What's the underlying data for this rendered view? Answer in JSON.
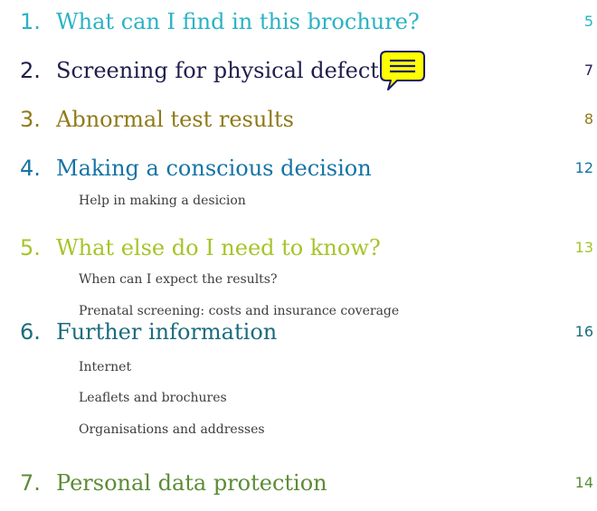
{
  "toc": {
    "entries": [
      {
        "number": "1.",
        "title": "What can I find in this brochure?",
        "page": "5",
        "color": "#2ab3c4",
        "subitems": []
      },
      {
        "number": "2.",
        "title": "Screening for physical defects",
        "page": "7",
        "color": "#1f1e4c",
        "subitems": []
      },
      {
        "number": "3.",
        "title": "Abnormal test results",
        "page": "8",
        "color": "#907a1a",
        "subitems": []
      },
      {
        "number": "4.",
        "title": "Making a conscious decision",
        "page": "12",
        "color": "#1574a6",
        "subitems": [
          "Help in making a desicion"
        ]
      },
      {
        "number": "5.",
        "title": "What else do I need to know?",
        "page": "13",
        "color": "#a6c42a",
        "subitems": [
          "When can I expect the results?",
          "Prenatal screening: costs and insurance coverage"
        ]
      },
      {
        "number": "6.",
        "title": "Further information",
        "page": "16",
        "color": "#1b6c7d",
        "subitems": [
          "Internet",
          "Leaflets and brochures",
          "Organisations and addresses"
        ]
      },
      {
        "number": "7.",
        "title": "Personal data protection",
        "page": "14",
        "color": "#5c8c36",
        "subitems": []
      }
    ]
  },
  "note_icon": {
    "name": "speech-bubble-note-icon",
    "fill": "#ffff00",
    "stroke": "#1a1a66"
  }
}
